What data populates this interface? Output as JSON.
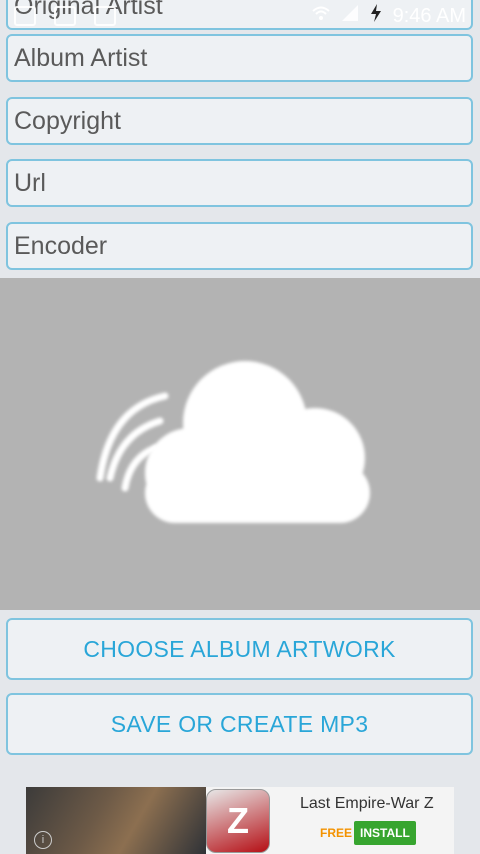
{
  "status_bar": {
    "time": "9:46 AM"
  },
  "fields": [
    {
      "label": "Original Artist"
    },
    {
      "label": "Album Artist"
    },
    {
      "label": "Copyright"
    },
    {
      "label": "Url"
    },
    {
      "label": "Encoder"
    }
  ],
  "buttons": {
    "choose_artwork": "CHOOSE ALBUM ARTWORK",
    "save": "SAVE OR CREATE MP3"
  },
  "ad": {
    "title": "Last Empire-War Z",
    "price": "FREE",
    "install": "INSTALL",
    "icon_letter": "Z",
    "info_glyph": "i"
  },
  "colors": {
    "accent": "#29a6d8",
    "border": "#7fc4df",
    "artwork_bg": "#b3b3b3",
    "install_bg": "#37a52f"
  }
}
